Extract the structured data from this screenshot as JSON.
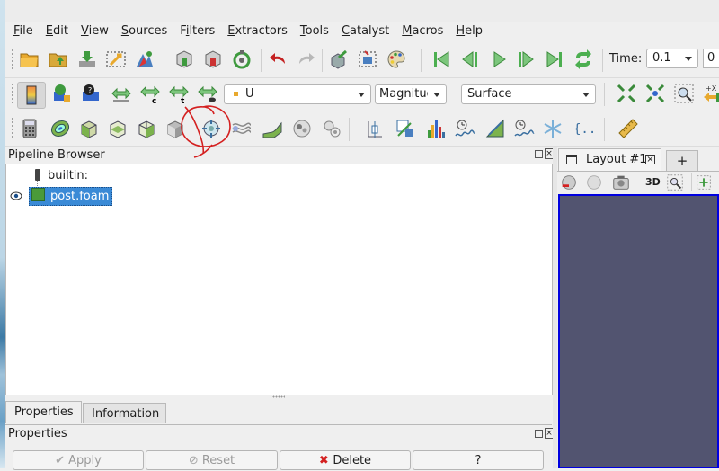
{
  "menu": [
    {
      "label": "File",
      "ul": "F"
    },
    {
      "label": "Edit",
      "ul": "E"
    },
    {
      "label": "View",
      "ul": "V"
    },
    {
      "label": "Sources",
      "ul": "S"
    },
    {
      "label": "Filters",
      "ul": "i"
    },
    {
      "label": "Extractors",
      "ul": "E"
    },
    {
      "label": "Tools",
      "ul": "T"
    },
    {
      "label": "Catalyst",
      "ul": "C"
    },
    {
      "label": "Macros",
      "ul": "M"
    },
    {
      "label": "Help",
      "ul": "H"
    }
  ],
  "time": {
    "label": "Time:",
    "value": "0.1",
    "index": "0"
  },
  "color_by": {
    "variable": "U",
    "component": "Magnitude"
  },
  "representation": "Surface",
  "pipeline": {
    "title": "Pipeline Browser",
    "items": [
      {
        "label": "builtin:"
      },
      {
        "label": "post.foam"
      }
    ]
  },
  "tabs": {
    "properties": "Properties",
    "information": "Information"
  },
  "properties": {
    "title": "Properties",
    "apply": "Apply",
    "reset": "Reset",
    "delete": "Delete",
    "help": "?"
  },
  "layout": {
    "tab_label": "Layout #1",
    "add_label": "+",
    "three_d": "3D"
  },
  "colors": {
    "view_bg": "#525470",
    "active_border": "#0000e0",
    "selection": "#3a8ad6",
    "annotation": "#d42020"
  }
}
